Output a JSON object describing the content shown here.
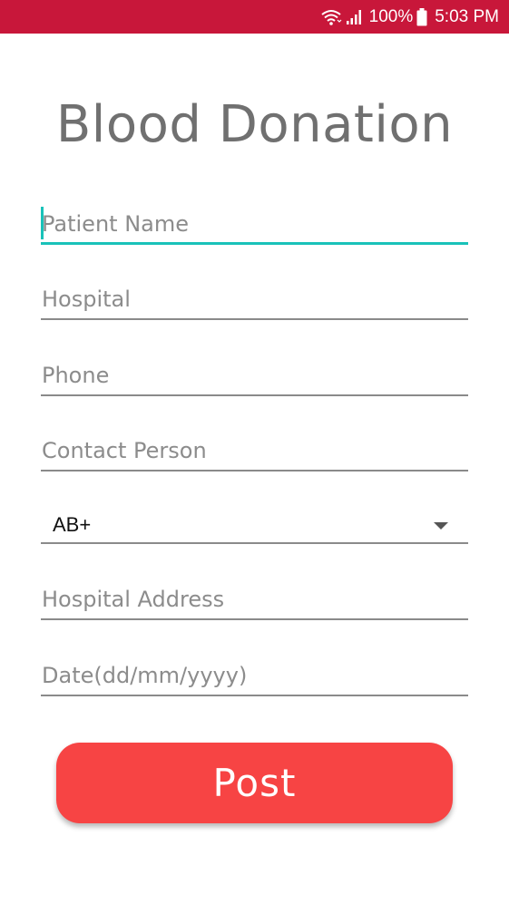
{
  "status_bar": {
    "battery_percent": "100%",
    "time": "5:03 PM",
    "background_color": "#c8173a",
    "icons": [
      "wifi-icon",
      "signal-icon",
      "battery-icon"
    ]
  },
  "form": {
    "title": "Blood Donation",
    "patient_name_placeholder": "Patient Name",
    "hospital_placeholder": "Hospital",
    "phone_placeholder": "Phone",
    "contact_person_placeholder": "Contact Person",
    "blood_group_value": "AB+",
    "hospital_address_placeholder": "Hospital Address",
    "date_placeholder": "Date(dd/mm/yyyy)",
    "post_label": "Post"
  },
  "colors": {
    "accent": "#19c2b9",
    "button": "#f74444",
    "title_text": "#707070"
  }
}
